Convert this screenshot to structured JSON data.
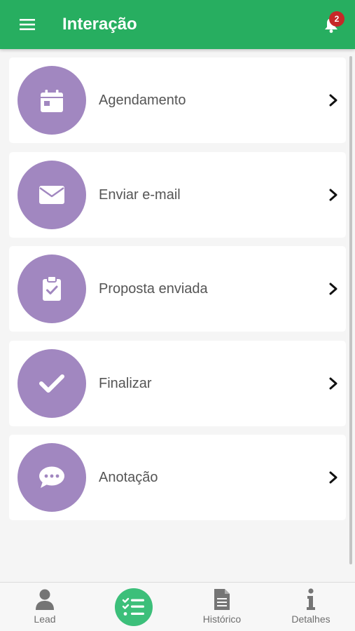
{
  "app_bar": {
    "title": "Interação",
    "notification_count": "2",
    "color": "#27ae60"
  },
  "actions": [
    {
      "label": "Agendamento",
      "icon": "calendar-icon"
    },
    {
      "label": "Enviar e-mail",
      "icon": "envelope-icon"
    },
    {
      "label": "Proposta enviada",
      "icon": "clipboard-check-icon"
    },
    {
      "label": "Finalizar",
      "icon": "check-icon"
    },
    {
      "label": "Anotação",
      "icon": "chat-bubble-icon"
    }
  ],
  "accent_color": "#a187c0",
  "bottom_nav": {
    "tabs": [
      {
        "label": "Lead",
        "icon": "user-icon"
      },
      {
        "label": "",
        "icon": "checklist-icon"
      },
      {
        "label": "Histórico",
        "icon": "document-icon"
      },
      {
        "label": "Detalhes",
        "icon": "info-icon"
      }
    ]
  }
}
